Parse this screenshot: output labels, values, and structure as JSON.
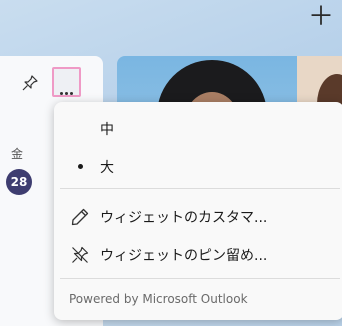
{
  "top_bar": {
    "plus_icon": "＋"
  },
  "widget": {
    "day_label": "金",
    "date": "28",
    "pin_icon": "pin-icon",
    "more_icon": "more-horizontal-icon"
  },
  "menu": {
    "items": [
      {
        "label": "中",
        "selected": false
      },
      {
        "label": "大",
        "selected": true
      },
      {
        "label": "ウィジェットのカスタマ...",
        "icon": "pencil-icon"
      },
      {
        "label": "ウィジェットのピン留め...",
        "icon": "unpin-icon"
      }
    ],
    "footer": "Powered by Microsoft Outlook"
  },
  "colors": {
    "highlight_border": "#ef9ac6",
    "date_badge": "#3e3d70",
    "menu_bg": "#f9f9f9"
  }
}
